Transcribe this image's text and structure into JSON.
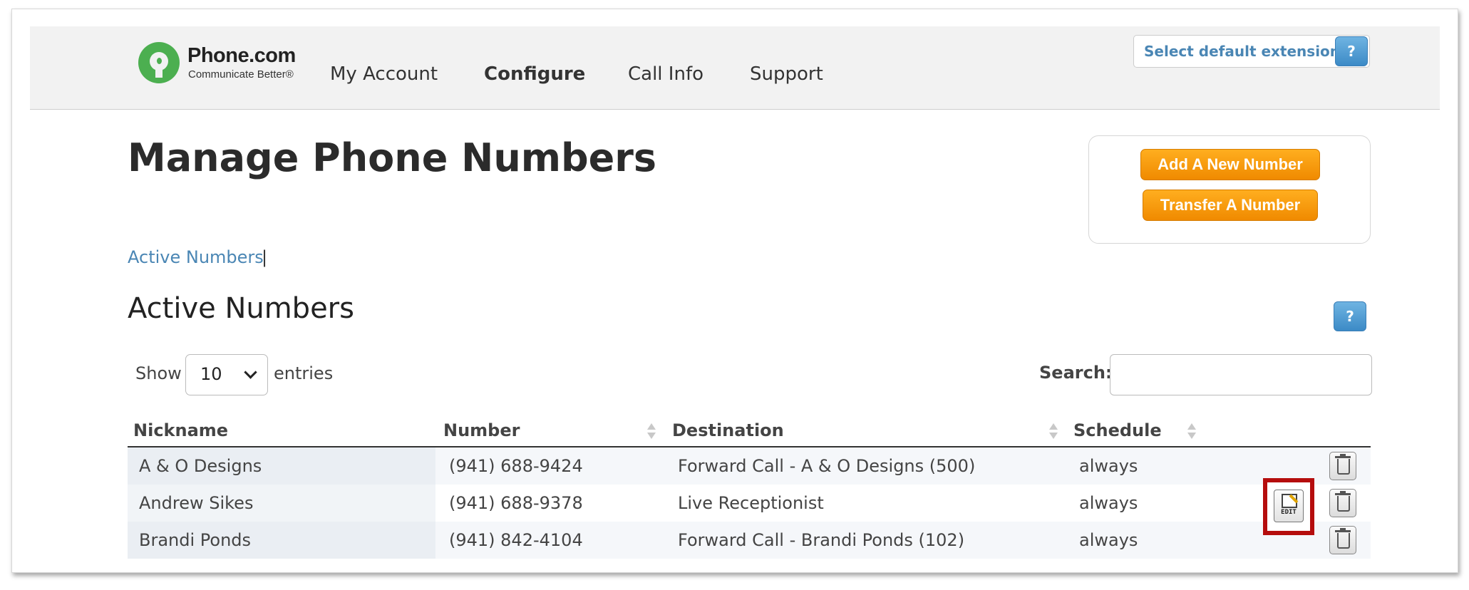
{
  "header": {
    "logo": {
      "name": "Phone.com",
      "tagline": "Communicate Better®"
    },
    "nav": [
      "My Account",
      "Configure",
      "Call Info",
      "Support"
    ],
    "active_nav": "Configure",
    "extension_select": {
      "label": "Select default extension"
    },
    "help_label": "?"
  },
  "page": {
    "title": "Manage Phone Numbers",
    "actions": {
      "add": "Add A New Number",
      "transfer": "Transfer A Number"
    },
    "tabs": {
      "active": "Active Numbers",
      "separator": "|"
    },
    "section_title": "Active Numbers",
    "help_label": "?"
  },
  "table_controls": {
    "show_label": "Show",
    "page_length": "10",
    "entries_label": "entries",
    "search_label": "Search:",
    "search_value": ""
  },
  "table": {
    "columns": [
      "Nickname",
      "Number",
      "Destination",
      "Schedule"
    ],
    "rows": [
      {
        "nickname": "A & O Designs",
        "number": "(941) 688-9424",
        "destination": "Forward Call - A & O Designs (500)",
        "schedule": "always"
      },
      {
        "nickname": "Andrew Sikes",
        "number": "(941) 688-9378",
        "destination": "Live Receptionist",
        "schedule": "always"
      },
      {
        "nickname": "Brandi Ponds",
        "number": "(941) 842-4104",
        "destination": "Forward Call - Brandi Ponds (102)",
        "schedule": "always"
      }
    ],
    "edit_label": "EDIT"
  },
  "colors": {
    "accent_orange": "#f59a0a",
    "link_blue": "#4a86b4",
    "help_blue": "#4d9bd6",
    "logo_green": "#4caf50",
    "highlight_red": "#b50d0d"
  }
}
